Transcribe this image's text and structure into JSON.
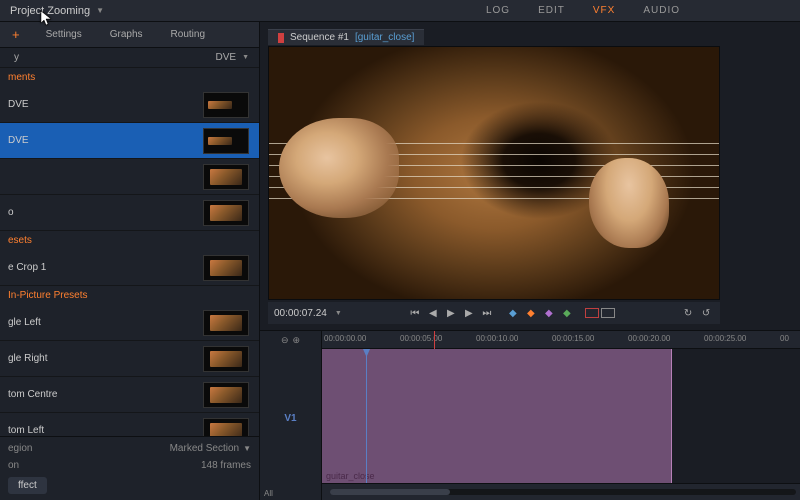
{
  "project_title": "Project Zooming",
  "main_tabs": {
    "log": "LOG",
    "edit": "EDIT",
    "vfx": "VFX",
    "audio": "AUDIO",
    "active": "vfx"
  },
  "left_tabs": {
    "add": "+",
    "settings": "Settings",
    "graphs": "Graphs",
    "routing": "Routing"
  },
  "dve_label": "DVE",
  "sections": {
    "y_label": "y",
    "elements": "ments",
    "effects": [
      {
        "name": "DVE",
        "selected": false
      },
      {
        "name": "DVE",
        "selected": true
      },
      {
        "name": "o",
        "selected": false
      }
    ],
    "presets_label": "esets",
    "presets": [
      {
        "name": "e Crop 1"
      }
    ],
    "pip_label": "In-Picture Presets",
    "pip_items": [
      {
        "name": "gle Left"
      },
      {
        "name": "gle Right"
      },
      {
        "name": "tom Centre"
      },
      {
        "name": "tom Left"
      }
    ]
  },
  "footer": {
    "region": "egion",
    "marked": "Marked Section",
    "on": "on",
    "frames": "148 frames",
    "apply": "ffect"
  },
  "sequence": {
    "name": "Sequence #1",
    "clip": "[guitar_close]"
  },
  "transport": {
    "timecode": "00:00:07.24"
  },
  "ruler": [
    "00:00:00.00",
    "00:00:05.00",
    "00:00:10.00",
    "00:00:15.00",
    "00:00:20.00",
    "00:00:25.00",
    "00"
  ],
  "track_label": "V1",
  "clip_name": "guitar_close",
  "all_label": "All"
}
